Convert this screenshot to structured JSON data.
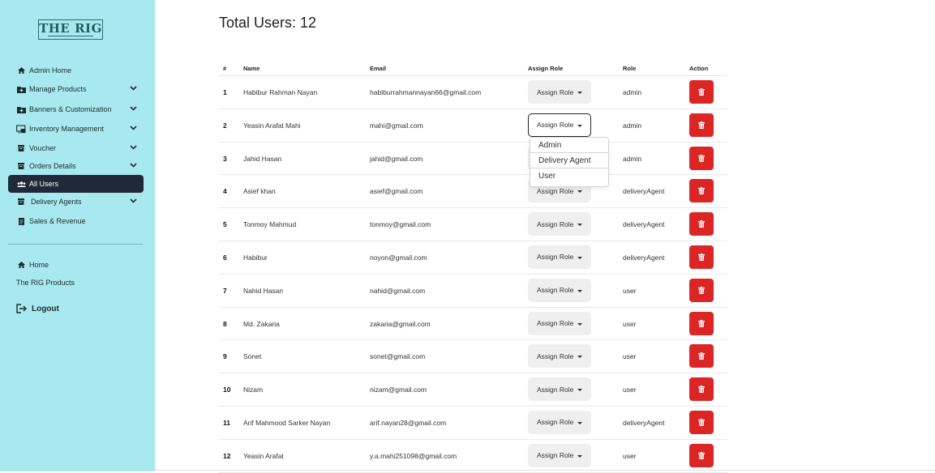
{
  "brand": {
    "logo_text": "THE RIG"
  },
  "sidebar": {
    "items": [
      {
        "label": "Admin Home",
        "icon": "home-icon",
        "chevron": false,
        "active": false
      },
      {
        "label": "Manage Products",
        "icon": "folder-plus-icon",
        "chevron": true,
        "active": false
      },
      {
        "label": "Banners & Customization",
        "icon": "folder-plus-icon",
        "chevron": true,
        "active": false
      },
      {
        "label": "Inventory Management",
        "icon": "inventory-icon",
        "chevron": true,
        "active": false
      },
      {
        "label": "Voucher",
        "icon": "box-icon",
        "chevron": true,
        "active": false
      },
      {
        "label": "Orders Details",
        "icon": "box-icon",
        "chevron": true,
        "active": false
      },
      {
        "label": "All Users",
        "icon": "users-icon",
        "chevron": false,
        "active": true
      },
      {
        "label": "Delivery Agents",
        "icon": "box-icon",
        "chevron": true,
        "active": false
      },
      {
        "label": "Sales & Revenue",
        "icon": "document-icon",
        "chevron": false,
        "active": false
      }
    ],
    "secondary": [
      {
        "label": "Home",
        "icon": "home-icon"
      },
      {
        "label": "The RIG Products",
        "icon": ""
      }
    ],
    "logout_label": "Logout"
  },
  "main": {
    "title": "Total Users: 12",
    "columns": [
      "#",
      "Name",
      "Email",
      "Assign Role",
      "Role",
      "Action"
    ],
    "assign_label": "Assign Role",
    "rows": [
      {
        "num": "1",
        "name": "Habibur Rahman Nayan",
        "email": "habiburrahmannayan66@gmail.com",
        "role": "admin"
      },
      {
        "num": "2",
        "name": "Yeasin Arafat Mahi",
        "email": "mahi@gmail.com",
        "role": "admin"
      },
      {
        "num": "3",
        "name": "Jahid Hasan",
        "email": "jahid@gmail.com",
        "role": "admin"
      },
      {
        "num": "4",
        "name": "Asief khan",
        "email": "asief@gmail.com",
        "role": "deliveryAgent"
      },
      {
        "num": "5",
        "name": "Tonmoy Mahmud",
        "email": "tonmoy@gmail.com",
        "role": "deliveryAgent"
      },
      {
        "num": "6",
        "name": "Habibur",
        "email": "noyon@gmail.com",
        "role": "deliveryAgent"
      },
      {
        "num": "7",
        "name": "Nahid Hasan",
        "email": "nahid@gmail.com",
        "role": "user"
      },
      {
        "num": "8",
        "name": "Md. Zakaria",
        "email": "zakaria@gmail.com",
        "role": "user"
      },
      {
        "num": "9",
        "name": "Sonet",
        "email": "sonet@gmail.com",
        "role": "user"
      },
      {
        "num": "10",
        "name": "Nizam",
        "email": "nizam@gmail.com",
        "role": "user"
      },
      {
        "num": "11",
        "name": "Arif Mahmood Sarker Nayan",
        "email": "arif.nayan28@gmail.com",
        "role": "deliveryAgent"
      },
      {
        "num": "12",
        "name": "Yeasin Arafat",
        "email": "y.a.mahi251098@gmail.com",
        "role": "user"
      }
    ],
    "open_dropdown_row": 2,
    "dropdown_options": [
      "Admin",
      "Delivery Agent",
      "User"
    ],
    "highlighted_option": "Delivery Agent"
  },
  "colors": {
    "sidebar_bg": "#a8e8ef",
    "active_bg": "#1f2937",
    "delete_bg": "#dc2626"
  }
}
